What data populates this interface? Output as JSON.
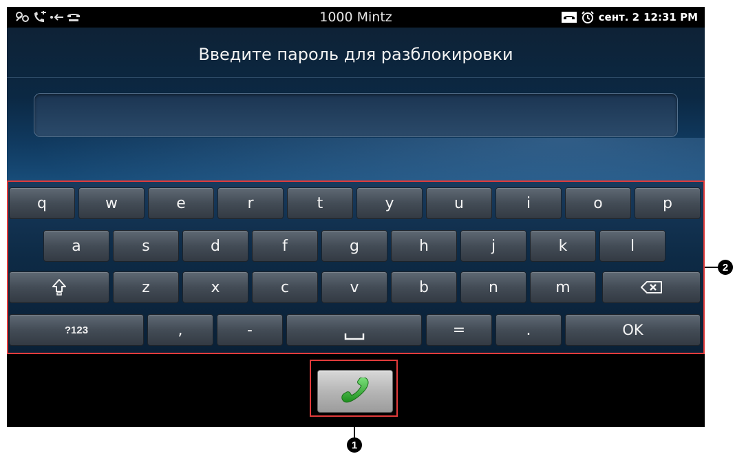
{
  "status_bar": {
    "title": "1000 Mintz",
    "date": "сент. 2",
    "time": "12:31 PM",
    "left_icons": [
      "voicemail-icon",
      "missed-call-icon",
      "back-arrow-icon",
      "phone-icon"
    ],
    "right_icons": [
      "handset-icon",
      "alarm-icon"
    ]
  },
  "unlock": {
    "prompt": "Введите пароль для разблокировки",
    "password_value": "",
    "password_placeholder": ""
  },
  "keyboard": {
    "row1": [
      "q",
      "w",
      "e",
      "r",
      "t",
      "y",
      "u",
      "i",
      "o",
      "p"
    ],
    "row2": [
      "a",
      "s",
      "d",
      "f",
      "g",
      "h",
      "j",
      "k",
      "l"
    ],
    "row3": [
      "z",
      "x",
      "c",
      "v",
      "b",
      "n",
      "m"
    ],
    "row4": {
      "symbols": "?123",
      "comma": ",",
      "dash": "-",
      "equals": "=",
      "period": ".",
      "ok": "OK"
    },
    "icons": [
      "shift-icon",
      "backspace-icon",
      "space-icon"
    ]
  },
  "call_button": {
    "icon": "phone-icon",
    "color": "#2fb52f"
  },
  "callouts": {
    "call_button": "1",
    "keyboard": "2",
    "color": "#e23b3b"
  }
}
